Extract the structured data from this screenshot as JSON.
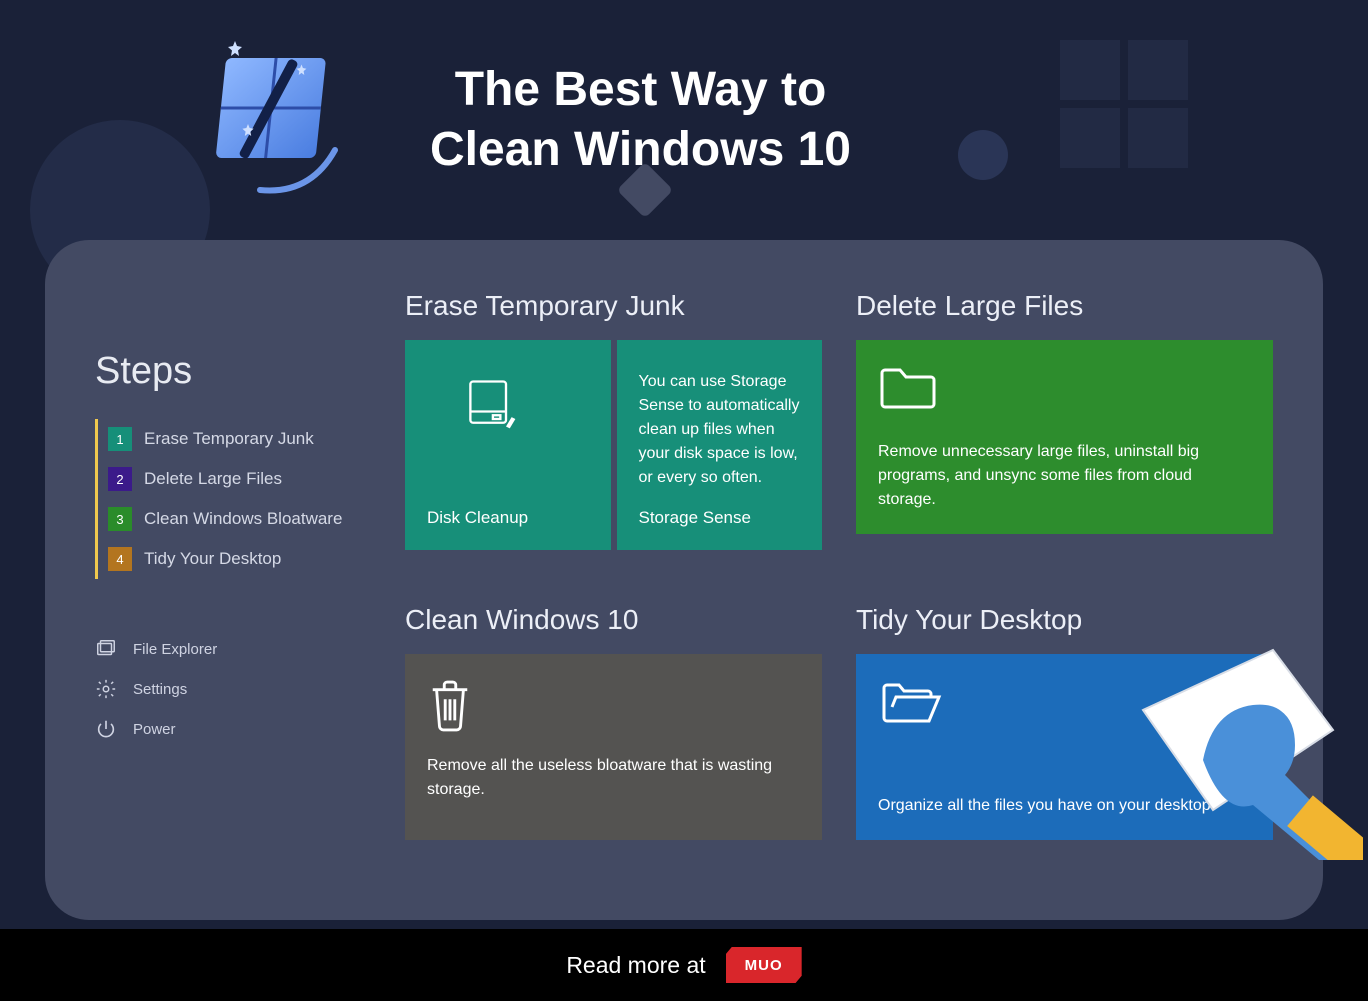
{
  "header": {
    "title_line1": "The Best Way to",
    "title_line2": "Clean Windows 10"
  },
  "sidebar": {
    "heading": "Steps",
    "steps": [
      {
        "num": "1",
        "label": "Erase Temporary Junk"
      },
      {
        "num": "2",
        "label": "Delete Large Files"
      },
      {
        "num": "3",
        "label": "Clean Windows Bloatware"
      },
      {
        "num": "4",
        "label": "Tidy Your Desktop"
      }
    ],
    "menu": [
      {
        "icon": "file-explorer",
        "label": "File Explorer"
      },
      {
        "icon": "settings",
        "label": "Settings"
      },
      {
        "icon": "power",
        "label": "Power"
      }
    ]
  },
  "cards": {
    "erase": {
      "title": "Erase Temporary Junk",
      "tile1_label": "Disk Cleanup",
      "tile2_desc": "You can use Storage Sense to automatically clean up files when your disk space is low, or every so often.",
      "tile2_label": "Storage Sense"
    },
    "delete": {
      "title": "Delete Large Files",
      "desc": "Remove unnecessary large files, uninstall big programs, and unsync some files from cloud storage."
    },
    "clean": {
      "title": "Clean Windows 10",
      "desc": "Remove all the useless bloatware that is wasting storage."
    },
    "tidy": {
      "title": "Tidy Your Desktop",
      "desc": "Organize all the files you have on your desktop."
    }
  },
  "footer": {
    "text": "Read more at",
    "brand": "MUO"
  },
  "colors": {
    "bg": "#1a2138",
    "panel": "#434a63",
    "teal": "#178f79",
    "green": "#2d8d2d",
    "gray": "#545351",
    "blue": "#1c6cba",
    "accent_bar": "#f0c94e",
    "muo_red": "#d9262b"
  }
}
